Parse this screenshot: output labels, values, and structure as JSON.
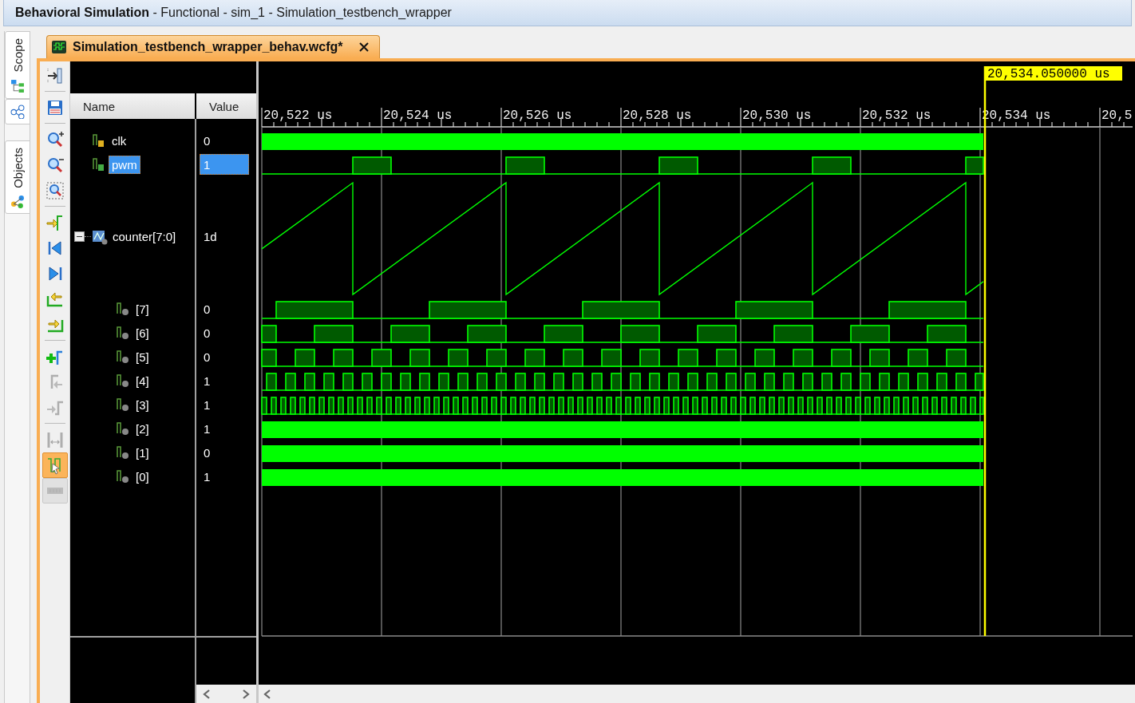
{
  "window": {
    "title": "**Behavioral Simulation** - Functional - sim_1 - Simulation_testbench_wrapper"
  },
  "side_tabs": [
    {
      "label": "Scope"
    },
    {
      "label": "Objects"
    }
  ],
  "editor_tab": {
    "label": "Simulation_testbench_wrapper_behav.wcfg*",
    "selected": true
  },
  "toolbar": [
    {
      "disabled": false,
      "selected": false
    },
    {
      "disabled": false,
      "selected": false
    },
    {
      "disabled": false,
      "selected": false
    },
    {
      "disabled": false,
      "selected": false
    },
    {
      "disabled": false,
      "selected": false
    },
    {
      "disabled": false,
      "selected": false
    },
    {
      "disabled": false,
      "selected": false
    },
    {
      "disabled": false,
      "selected": false
    },
    {
      "disabled": false,
      "selected": false
    },
    {
      "disabled": false,
      "selected": false
    },
    {
      "disabled": false,
      "selected": false
    },
    {
      "disabled": true,
      "selected": false
    },
    {
      "disabled": true,
      "selected": false
    },
    {
      "disabled": true,
      "selected": false
    },
    {
      "disabled": false,
      "selected": true
    },
    {
      "disabled": true,
      "selected": false
    }
  ],
  "columns": [
    "Name",
    "Value"
  ],
  "signals": [
    {
      "name": "clk",
      "value": "0",
      "kind": "clock",
      "selected": false
    },
    {
      "name": "pwm",
      "value": "1",
      "kind": "pwm",
      "selected": true
    },
    {
      "name": "counter[7:0]",
      "value": "1d",
      "kind": "bus",
      "selected": false,
      "expanded": true,
      "children": [
        {
          "name": "[7]",
          "value": "0",
          "kind": "bit",
          "selected": false
        },
        {
          "name": "[6]",
          "value": "0",
          "kind": "bit",
          "selected": false
        },
        {
          "name": "[5]",
          "value": "0",
          "kind": "bit",
          "selected": false
        },
        {
          "name": "[4]",
          "value": "1",
          "kind": "bit",
          "selected": false
        },
        {
          "name": "[3]",
          "value": "1",
          "kind": "bit",
          "selected": false
        },
        {
          "name": "[2]",
          "value": "1",
          "kind": "bit",
          "selected": false
        },
        {
          "name": "[1]",
          "value": "0",
          "kind": "bit",
          "selected": false
        },
        {
          "name": "[0]",
          "value": "1",
          "kind": "bit",
          "selected": false
        }
      ]
    }
  ],
  "timeline": {
    "ticks": [
      "20,522 us",
      "20,524 us",
      "20,526 us",
      "20,528 us",
      "20,530 us",
      "20,532 us",
      "20,534 us",
      "20,5"
    ],
    "cursor": "20,534.050000 us"
  }
}
